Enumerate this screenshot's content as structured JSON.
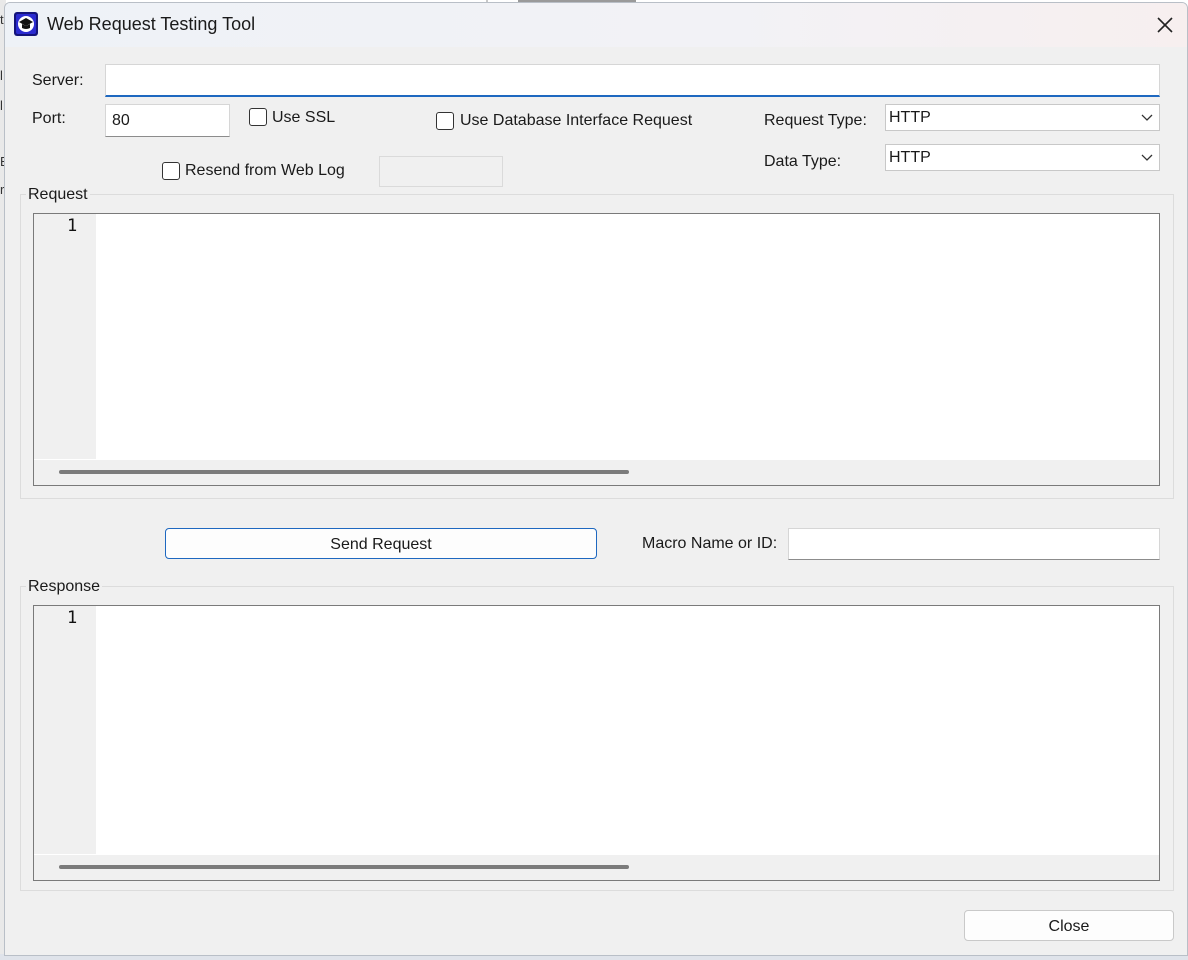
{
  "window": {
    "title": "Web Request Testing Tool"
  },
  "form": {
    "server_label": "Server:",
    "server_value": "",
    "port_label": "Port:",
    "port_value": "80",
    "use_ssl_label": "Use SSL",
    "use_ssl_checked": false,
    "use_db_label": "Use Database Interface Request",
    "use_db_checked": false,
    "resend_label": "Resend from Web Log",
    "resend_checked": false,
    "request_type_label": "Request Type:",
    "request_type_value": "HTTP",
    "data_type_label": "Data Type:",
    "data_type_value": "HTTP"
  },
  "request": {
    "title": "Request",
    "line_number": "1",
    "content": ""
  },
  "actions": {
    "send_label": "Send Request",
    "macro_label": "Macro Name or ID:",
    "macro_value": ""
  },
  "response": {
    "title": "Response",
    "line_number": "1",
    "content": ""
  },
  "footer": {
    "close_label": "Close"
  },
  "colors": {
    "focus_accent": "#1e68c0",
    "window_bg": "#f0f0f0"
  },
  "icons": {
    "app": "graduation-cap-icon",
    "close": "close-icon",
    "dropdown": "chevron-down-icon"
  }
}
